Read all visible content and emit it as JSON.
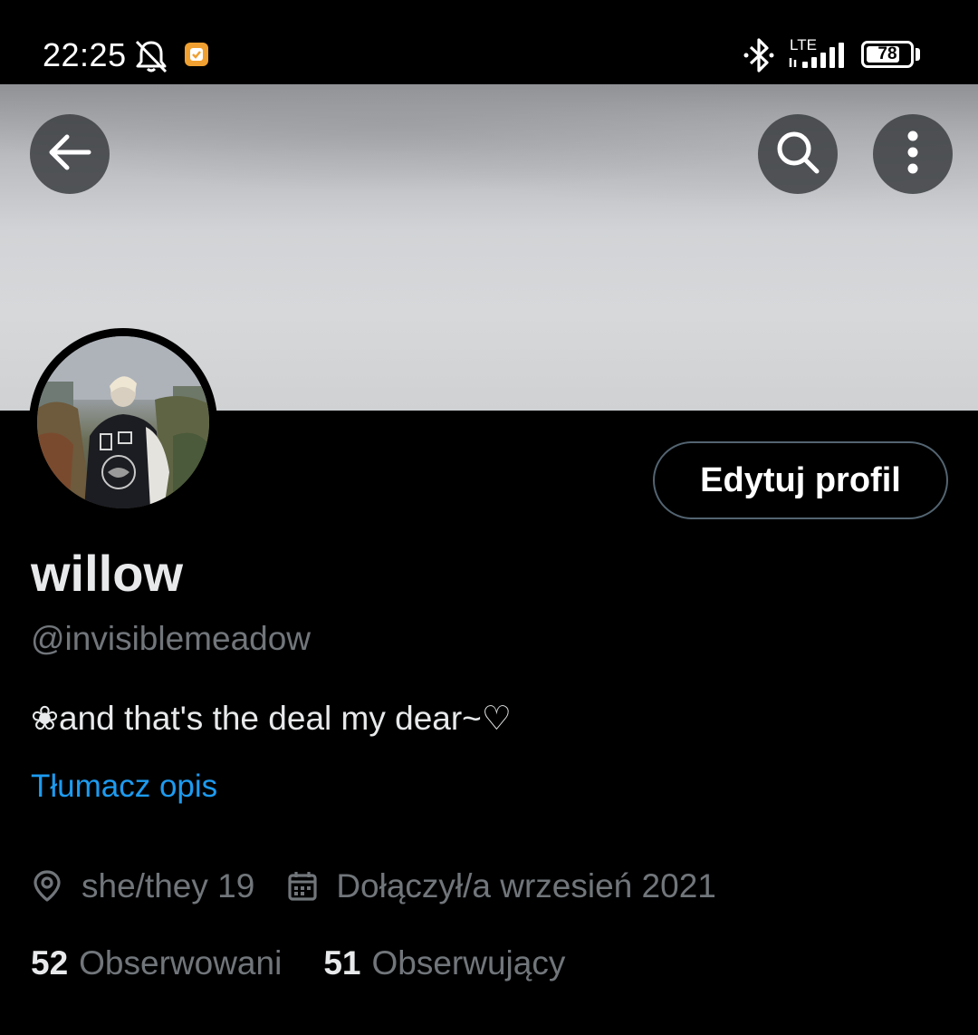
{
  "status_bar": {
    "time": "22:25",
    "network": "LTE",
    "battery": "78",
    "battery_level": 0.78,
    "icons": [
      "bell-off-icon",
      "notification-app-icon",
      "bluetooth-icon",
      "signal-icon",
      "battery-icon"
    ]
  },
  "header": {
    "back_icon": "arrow-left-icon",
    "search_icon": "search-icon",
    "more_icon": "more-vertical-icon"
  },
  "profile": {
    "display_name": "willow",
    "handle": "@invisiblemeadow",
    "bio": "❀and that's the deal my dear~♡",
    "translate_label": "Tłumacz opis",
    "edit_button": "Edytuj profil",
    "location": "she/they 19",
    "joined": "Dołączył/a wrzesień 2021",
    "following_count": "52",
    "following_label": "Obserwowani",
    "followers_count": "51",
    "followers_label": "Obserwujący"
  },
  "colors": {
    "background": "#000000",
    "primary_text": "#e7e9ea",
    "secondary_text": "#71767b",
    "link": "#1d9bf0",
    "button_border": "#536471"
  }
}
